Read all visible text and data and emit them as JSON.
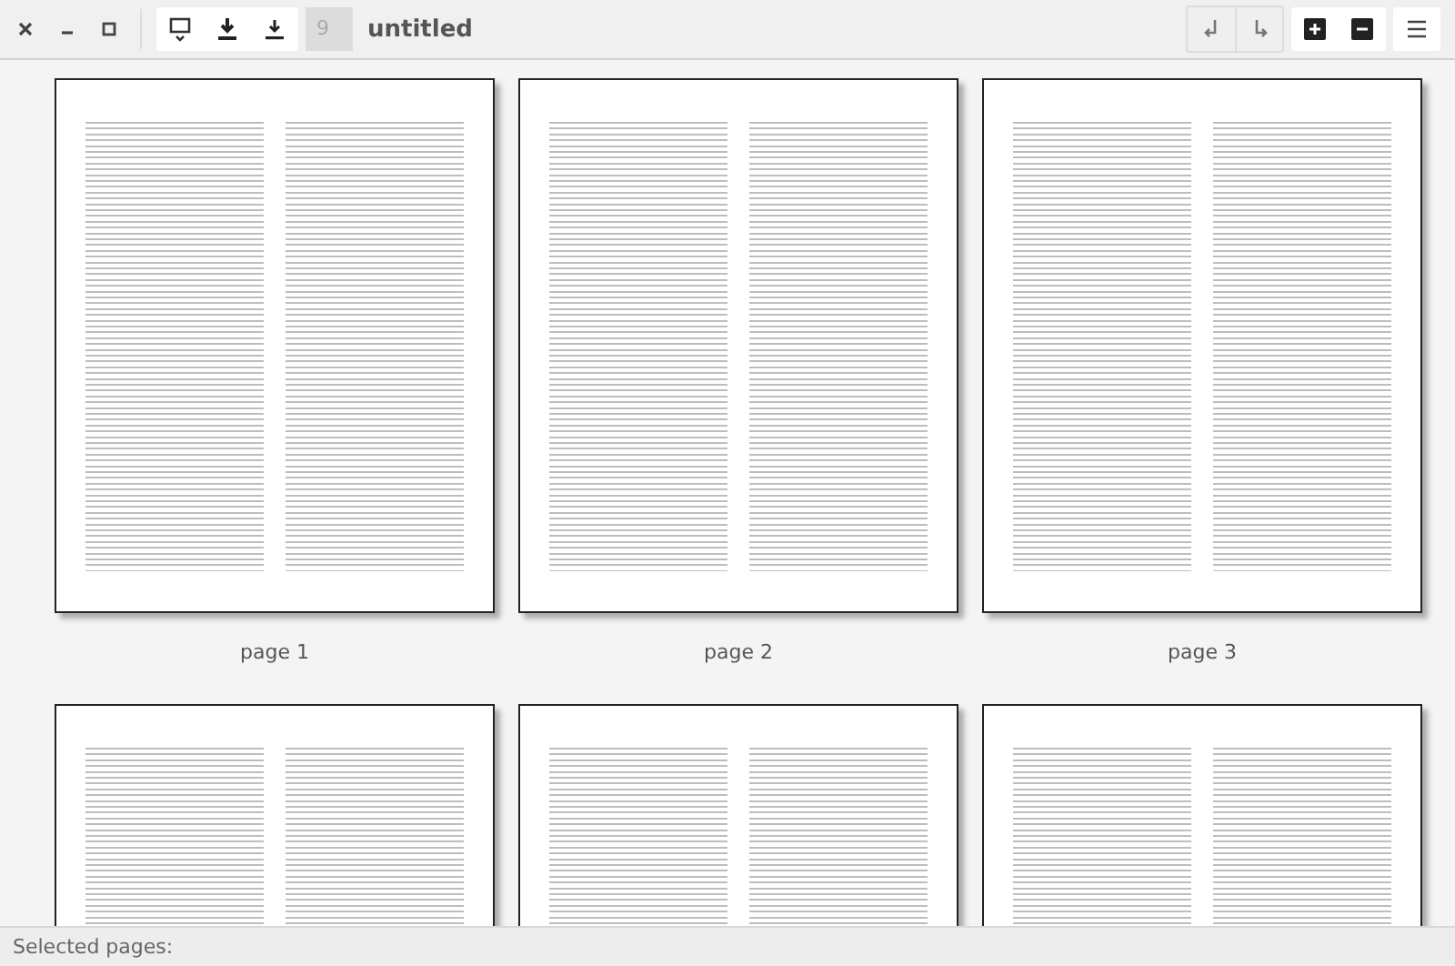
{
  "window": {
    "title": "untitled",
    "zoom": "9"
  },
  "pages": [
    {
      "label": "page 1",
      "kind": "document"
    },
    {
      "label": "page 2",
      "kind": "document"
    },
    {
      "label": "page 3",
      "kind": "document"
    },
    {
      "kind": "document"
    },
    {
      "kind": "document"
    },
    {
      "kind": "document"
    }
  ],
  "status_bar": {
    "text": "Selected pages:"
  }
}
